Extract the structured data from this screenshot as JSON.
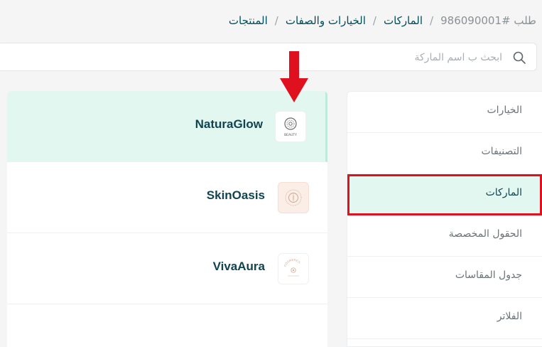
{
  "breadcrumb": {
    "items": [
      "المنتجات",
      "الخيارات والصفات",
      "الماركات"
    ],
    "current": "طلب #986090001",
    "separator": "/"
  },
  "search": {
    "placeholder": "ابحث ب اسم الماركة",
    "value": ""
  },
  "brands": [
    {
      "name": "NaturaGlow",
      "logo_text": "BEAUTY",
      "active": true
    },
    {
      "name": "SkinOasis",
      "logo_text": "",
      "active": false
    },
    {
      "name": "VivaAura",
      "logo_text": "COSMETICS",
      "active": false
    }
  ],
  "menu": {
    "items": [
      {
        "label": "الخيارات",
        "active": false
      },
      {
        "label": "التصنيفات",
        "active": false
      },
      {
        "label": "الماركات",
        "active": true
      },
      {
        "label": "الحقول المخصصة",
        "active": false
      },
      {
        "label": "جدول المقاسات",
        "active": false
      },
      {
        "label": "الفلاتر",
        "active": false
      }
    ]
  },
  "colors": {
    "accent": "#004d5a",
    "active_bg": "#e3f7f1",
    "highlight_red": "#e0111f"
  }
}
